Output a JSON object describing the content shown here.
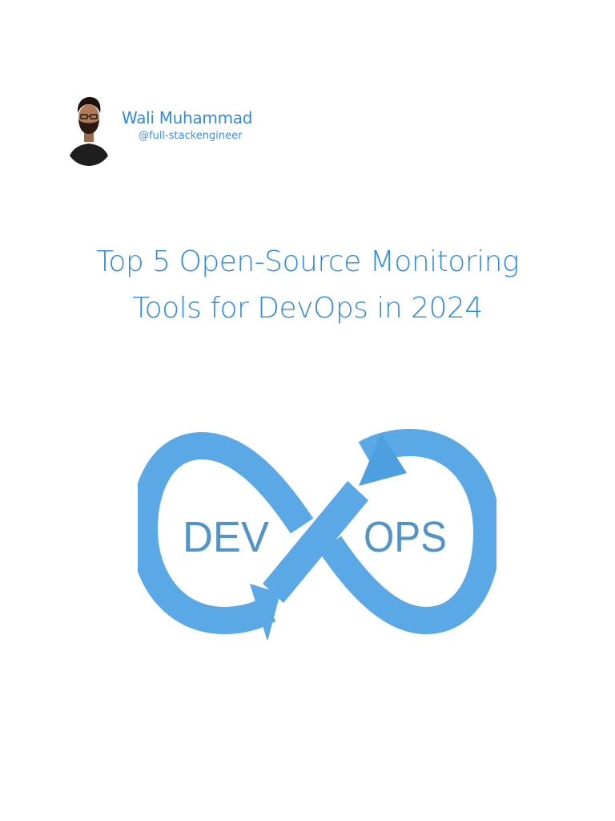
{
  "author": {
    "name": "Wali Muhammad",
    "handle": "@full-stackengineer"
  },
  "title": {
    "line1": "Top 5 Open-Source Monitoring",
    "line2": "Tools for DevOps in 2024"
  },
  "logo": {
    "left_text": "DEV",
    "right_text": "OPS",
    "color": "#5aa9e6",
    "text_color": "#5293c8"
  },
  "colors": {
    "accent": "#2f8be0",
    "background": "#ffffff"
  }
}
